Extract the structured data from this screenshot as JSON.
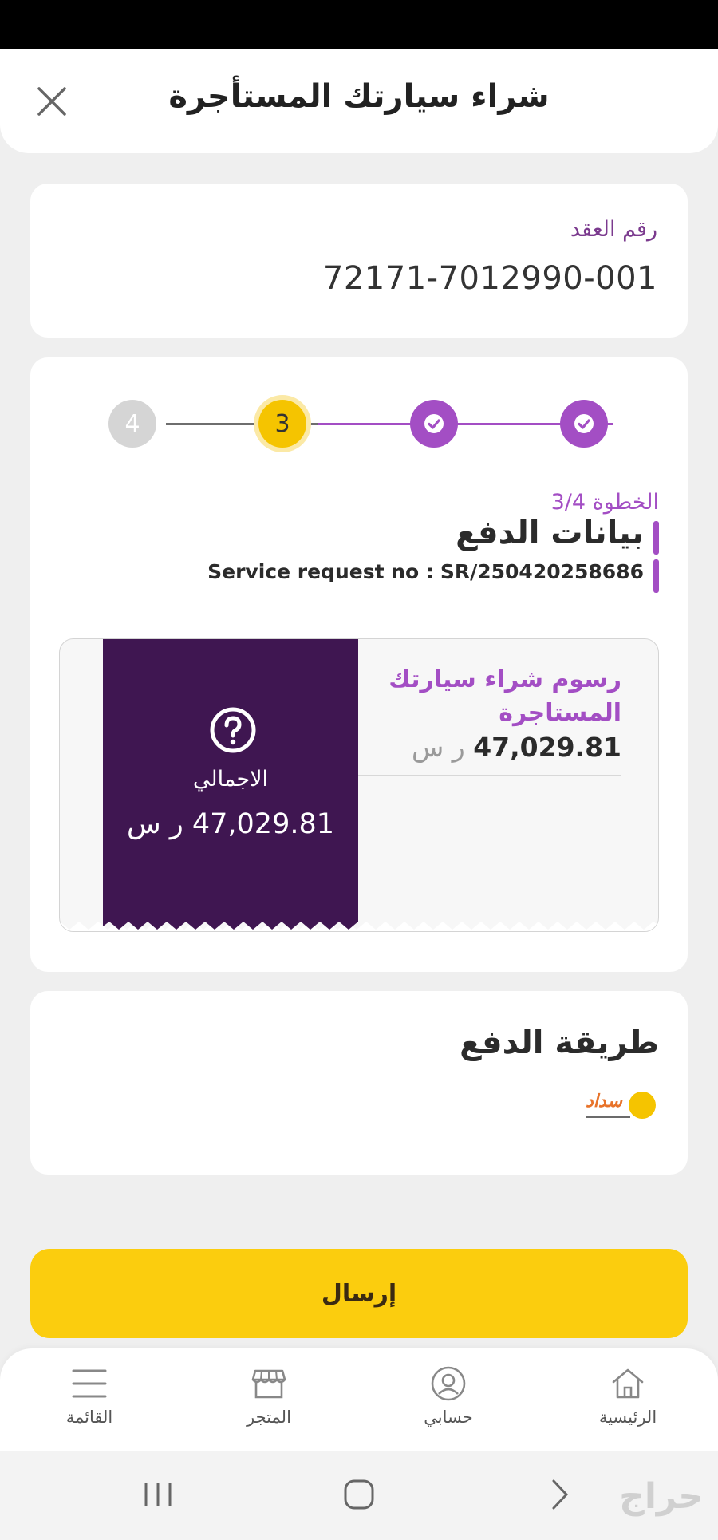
{
  "header": {
    "title": "شراء سيارتك المستأجرة",
    "close_icon": "close-icon"
  },
  "contract": {
    "label": "رقم العقد",
    "number": "72171-7012990-001"
  },
  "stepper": {
    "current": 3,
    "total": 4,
    "steps": [
      {
        "label": "4",
        "state": "todo"
      },
      {
        "label": "3",
        "state": "current"
      },
      {
        "label": "",
        "state": "done",
        "icon": "check-icon"
      },
      {
        "label": "",
        "state": "done",
        "icon": "check-icon"
      }
    ],
    "colors": {
      "done": "#a34ec4",
      "current": "#f5c400",
      "todo": "#d5d5d5"
    }
  },
  "payment": {
    "step_caption": "الخطوة 3/4",
    "title": "بيانات الدفع",
    "service_request_label": "Service request no :",
    "service_request_value": "SR/250420258686",
    "fee_title": "رسوم شراء سيارتك المستاجرة",
    "fee_amount": "47,029.81",
    "currency": "ر س",
    "total_label": "الاجمالي",
    "total_amount": "47,029.81",
    "help_icon": "question-circle-icon"
  },
  "payment_method": {
    "title": "طريقة الدفع",
    "option_label": "سداد",
    "selected": true,
    "accent": "#f5c400"
  },
  "actions": {
    "submit_label": "إرسال"
  },
  "bottom_nav": {
    "items": [
      {
        "label": "الرئيسية",
        "icon": "home-icon"
      },
      {
        "label": "حسابي",
        "icon": "account-icon"
      },
      {
        "label": "المتجر",
        "icon": "store-icon"
      },
      {
        "label": "القائمة",
        "icon": "menu-icon"
      }
    ]
  },
  "system_nav": {
    "watermark": "حراج"
  }
}
